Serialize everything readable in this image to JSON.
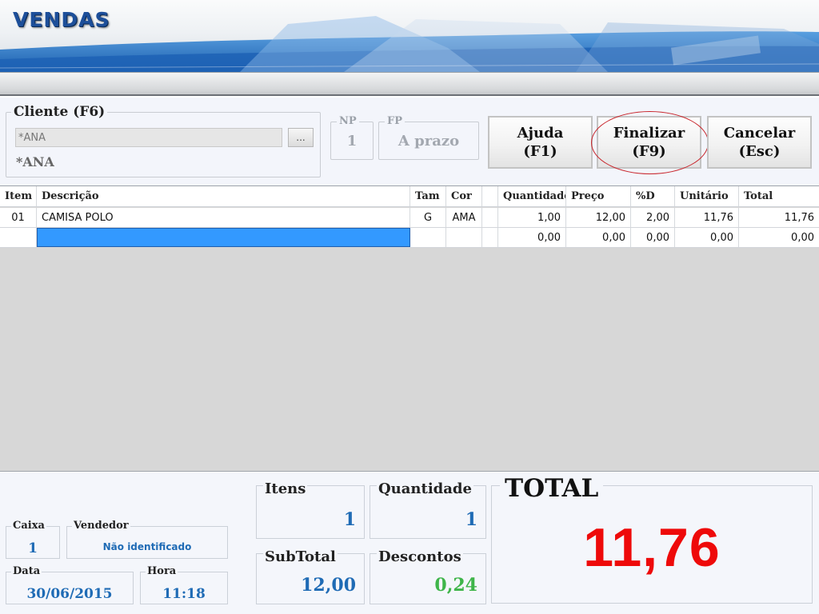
{
  "app": {
    "title": "VENDAS"
  },
  "client": {
    "label": "Cliente (F6)",
    "input_value": "*ANA",
    "lookup_button": "...",
    "name": "*ANA"
  },
  "np": {
    "label": "NP",
    "value": "1"
  },
  "fp": {
    "label": "FP",
    "value": "A prazo"
  },
  "buttons": {
    "help": {
      "line1": "Ajuda",
      "line2": "(F1)"
    },
    "finish": {
      "line1": "Finalizar",
      "line2": "(F9)"
    },
    "cancel": {
      "line1": "Cancelar",
      "line2": "(Esc)"
    }
  },
  "grid": {
    "columns": [
      "Item",
      "Descrição",
      "Tam",
      "Cor",
      "",
      "Quantidade",
      "Preço",
      "%D",
      "Unitário",
      "Total"
    ],
    "rows": [
      [
        "01",
        "CAMISA POLO",
        "G",
        "AMA",
        "",
        "1,00",
        "12,00",
        "2,00",
        "11,76",
        "11,76"
      ],
      [
        "",
        "",
        "",
        "",
        "",
        "0,00",
        "0,00",
        "0,00",
        "0,00",
        "0,00"
      ]
    ]
  },
  "footer": {
    "caixa": {
      "label": "Caixa",
      "value": "1"
    },
    "vendedor": {
      "label": "Vendedor",
      "value": "Não identificado"
    },
    "data": {
      "label": "Data",
      "value": "30/06/2015"
    },
    "hora": {
      "label": "Hora",
      "value": "11:18"
    },
    "itens": {
      "label": "Itens",
      "value": "1"
    },
    "quantidade": {
      "label": "Quantidade",
      "value": "1"
    },
    "subtotal": {
      "label": "SubTotal",
      "value": "12,00"
    },
    "descontos": {
      "label": "Descontos",
      "value": "0,24"
    },
    "total": {
      "label": "TOTAL",
      "value": "11,76"
    }
  },
  "colors": {
    "title_blue": "#1d4f9a",
    "value_blue": "#1f6bb5",
    "discount_green": "#3fb54a",
    "total_red": "#ee0a0a",
    "selection_blue": "#3399ff",
    "highlight_ring": "#c8242b"
  }
}
